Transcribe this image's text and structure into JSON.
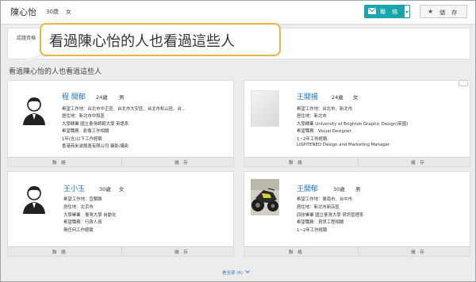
{
  "header": {
    "name": "陳心怡",
    "age": "30歲",
    "sex": "女",
    "contact_label": "聯 絡",
    "save_label": "儲 存"
  },
  "cert": {
    "label": "認證資格"
  },
  "callout": {
    "text": "看過陳心怡的人也看過這些人"
  },
  "section": {
    "title": "看過陳心怡的人也看過這些人"
  },
  "cards": [
    {
      "name": "程 開郁",
      "age": "24歲",
      "sex": "男",
      "photo": "male-avatar",
      "lines": [
        "希望工作地：台北市中正區、台北市大安區、台北市松山區、台...",
        "居住地：新北市中和區",
        "大學肄業 國立臺灣師範大學 英語系",
        "希望職務：影像工作相關",
        "1年(含)以下工作經驗",
        "香港商米波鳳凰有限公司 攝影/攝影"
      ],
      "contact": "聯 絡",
      "save": "儲 存"
    },
    {
      "name": "王開揚",
      "age": "24歲",
      "sex": "女",
      "photo": "blank-photo",
      "lines": [
        "希望工作地：台北市、新北市",
        "居住地：新北市",
        "大學肄業 University of Brighton Graphic Design(英國)",
        "希望職務：Visual Designer",
        "1~2年工作經驗",
        "LIGHTENED Design and Marketing Manager"
      ],
      "contact": "聯 絡",
      "save": "儲 存"
    },
    {
      "name": "王小玉",
      "age": "30歲",
      "sex": "女",
      "photo": "male-avatar",
      "lines": [
        "希望工作地：宜蘭縣",
        "居住地：北京市",
        "大學畢業　臺灣大學 自動化",
        "希望職務：行政人員",
        "無任何工作經驗"
      ],
      "contact": "聯 絡",
      "save": "儲 存"
    },
    {
      "name": "王開郁",
      "age": "30歲",
      "sex": "男",
      "photo": "motorcycle-photo",
      "lines": [
        "希望工作地：臺南市、台中市",
        "居住地：新北市新店區",
        "四技畢業 國立臺灣大學 資訊管理系",
        "希望職務：資訊工程相關",
        "1~2年工作經驗"
      ],
      "contact": "聯 絡",
      "save": "儲 存"
    }
  ],
  "more": {
    "label": "看全部 (6)"
  }
}
